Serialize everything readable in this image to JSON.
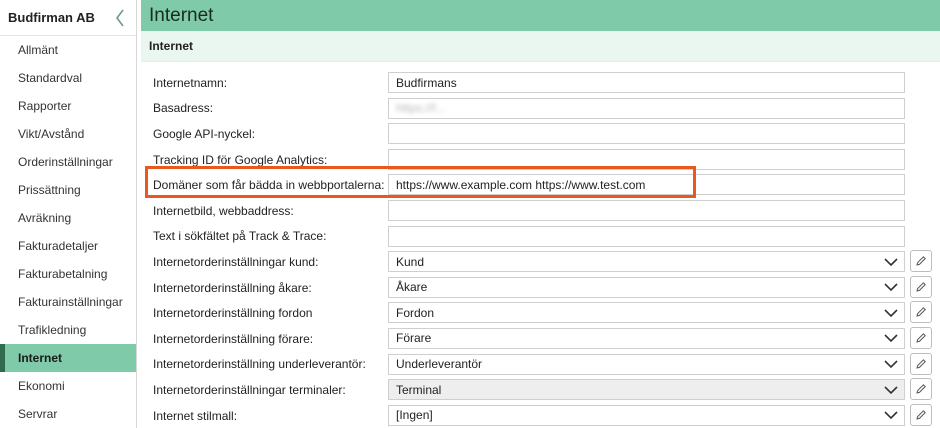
{
  "sidebar": {
    "title": "Budfirman AB",
    "items": [
      {
        "label": "Allmänt",
        "active": false
      },
      {
        "label": "Standardval",
        "active": false
      },
      {
        "label": "Rapporter",
        "active": false
      },
      {
        "label": "Vikt/Avstånd",
        "active": false
      },
      {
        "label": "Orderinställningar",
        "active": false
      },
      {
        "label": "Prissättning",
        "active": false
      },
      {
        "label": "Avräkning",
        "active": false
      },
      {
        "label": "Fakturadetaljer",
        "active": false
      },
      {
        "label": "Fakturabetalning",
        "active": false
      },
      {
        "label": "Fakturainställningar",
        "active": false
      },
      {
        "label": "Trafikledning",
        "active": false
      },
      {
        "label": "Internet",
        "active": true
      },
      {
        "label": "Ekonomi",
        "active": false
      },
      {
        "label": "Servrar",
        "active": false
      }
    ]
  },
  "header": {
    "title": "Internet"
  },
  "section": {
    "title": "Internet"
  },
  "form": {
    "internet_name": {
      "label": "Internetnamn:",
      "value": "Budfirmans"
    },
    "base_address": {
      "label": "Basadress:",
      "value": "https://f..."
    },
    "google_api_key": {
      "label": "Google API-nyckel:",
      "value": ""
    },
    "tracking_id": {
      "label": "Tracking ID för Google Analytics:",
      "value": ""
    },
    "embed_domains": {
      "label": "Domäner som får bädda in webbportalerna:",
      "value": "https://www.example.com https://www.test.com"
    },
    "internet_image": {
      "label": "Internetbild, webbaddress:",
      "value": ""
    },
    "search_text": {
      "label": "Text i sökfältet på Track & Trace:",
      "value": ""
    },
    "order_customer": {
      "label": "Internetorderinställningar kund:",
      "value": "Kund"
    },
    "order_owner": {
      "label": "Internetorderinställning åkare:",
      "value": "Åkare"
    },
    "order_vehicle": {
      "label": "Internetorderinställning fordon",
      "value": "Fordon"
    },
    "order_driver": {
      "label": "Internetorderinställning förare:",
      "value": "Förare"
    },
    "order_subcontractor": {
      "label": "Internetorderinställning underleverantör:",
      "value": "Underleverantör"
    },
    "order_terminals": {
      "label": "Internetorderinställningar terminaler:",
      "value": "Terminal"
    },
    "stylesheet": {
      "label": "Internet stilmall:",
      "value": "[Ingen]"
    }
  },
  "colors": {
    "accent": "#7fcaa8",
    "highlight": "#e8591f",
    "active_marker": "#2e6b4f"
  }
}
